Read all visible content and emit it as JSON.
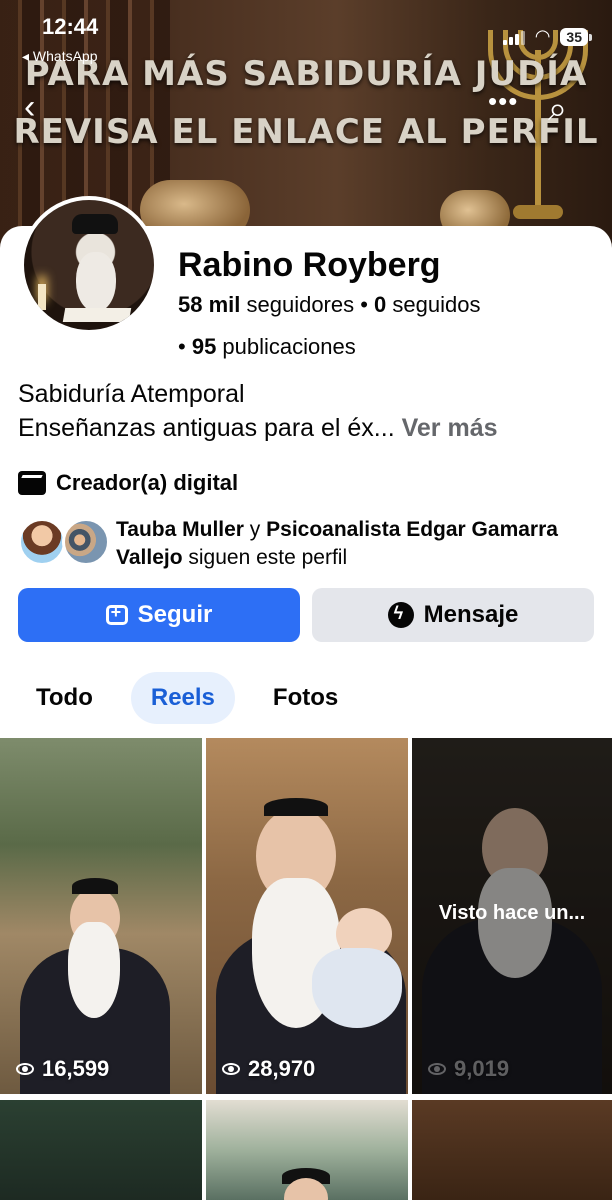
{
  "status_bar": {
    "time": "12:44",
    "back_app": "◂ WhatsApp",
    "battery": "35"
  },
  "cover": {
    "line1": "PARA MÁS SABIDURÍA JUDÍA",
    "line2": "REVISA EL ENLACE AL PERFIL"
  },
  "nav": {
    "back_icon": "‹",
    "more_icon": "•••",
    "search_icon": "⌕"
  },
  "profile": {
    "name": "Rabino Royberg",
    "followers_count": "58 mil",
    "followers_label": " seguidores • ",
    "following_count": "0",
    "following_label": " seguidos",
    "posts_prefix": "• ",
    "posts_count": "95",
    "posts_label": " publicaciones",
    "bio_line1": "Sabiduría Atemporal",
    "bio_line2": "Enseñanzas antiguas para el éx... ",
    "see_more": "Ver más",
    "category": "Creador(a) digital"
  },
  "mutual": {
    "friend1": "Tauba Muller",
    "connector": " y ",
    "friend2": "Psicoanalista Edgar Gamarra Vallejo",
    "suffix": " siguen este perfil"
  },
  "actions": {
    "follow": "Seguir",
    "message": "Mensaje"
  },
  "tabs": [
    {
      "label": "Todo",
      "active": false
    },
    {
      "label": "Reels",
      "active": true
    },
    {
      "label": "Fotos",
      "active": false
    }
  ],
  "reels": [
    {
      "views": "16,599"
    },
    {
      "views": "28,970"
    },
    {
      "views": "9,019",
      "overlay": "Visto hace un..."
    }
  ]
}
